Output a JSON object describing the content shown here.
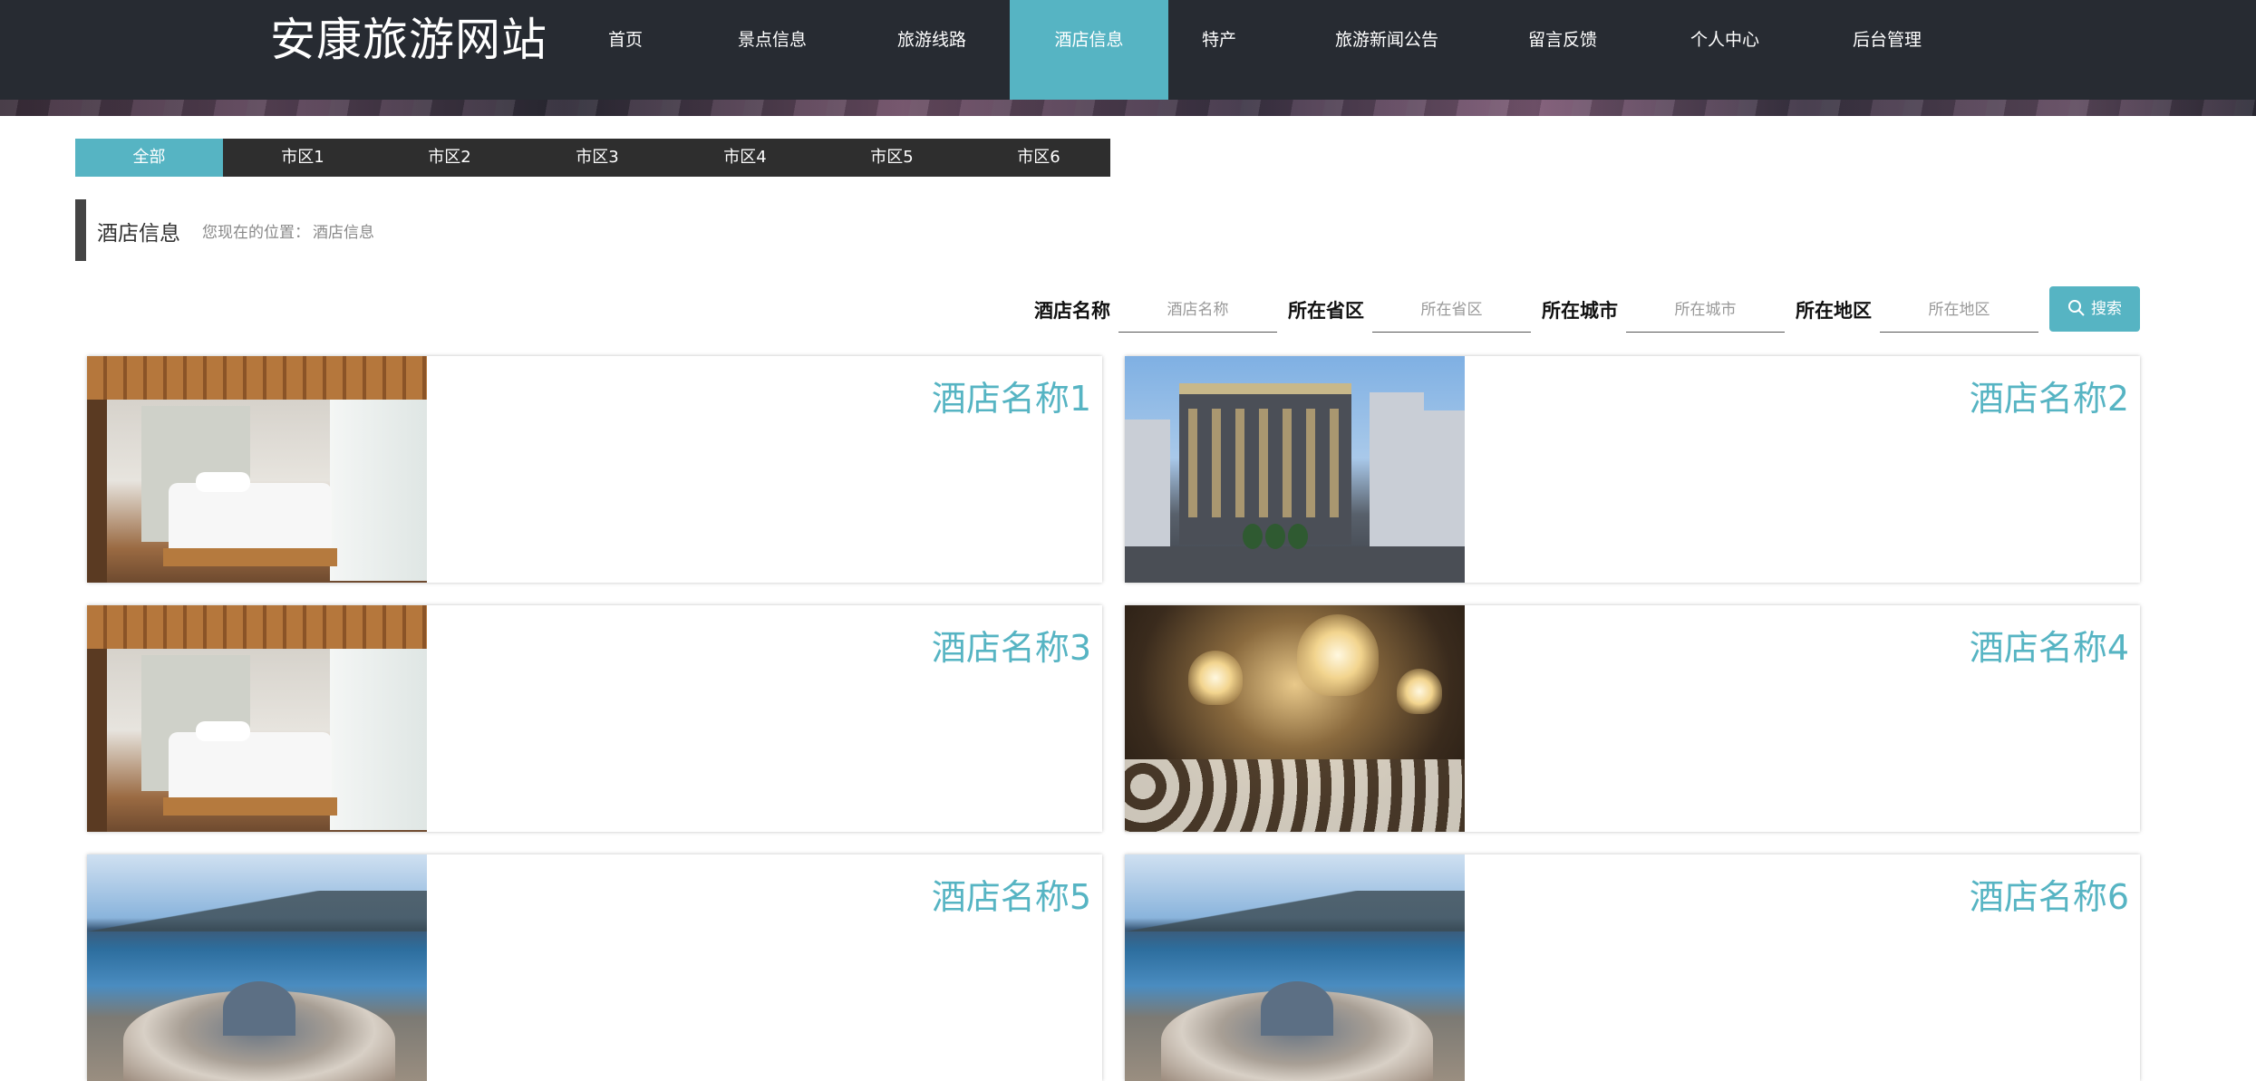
{
  "header": {
    "site_title": "安康旅游网站",
    "nav": [
      {
        "label": "首页",
        "active": false
      },
      {
        "label": "景点信息",
        "active": false
      },
      {
        "label": "旅游线路",
        "active": false
      },
      {
        "label": "酒店信息",
        "active": true
      },
      {
        "label": "特产",
        "active": false
      },
      {
        "label": "旅游新闻公告",
        "active": false
      },
      {
        "label": "留言反馈",
        "active": false
      },
      {
        "label": "个人中心",
        "active": false
      },
      {
        "label": "后台管理",
        "active": false
      }
    ]
  },
  "districts": {
    "tabs": [
      {
        "label": "全部",
        "active": true
      },
      {
        "label": "市区1",
        "active": false
      },
      {
        "label": "市区2",
        "active": false
      },
      {
        "label": "市区3",
        "active": false
      },
      {
        "label": "市区4",
        "active": false
      },
      {
        "label": "市区5",
        "active": false
      },
      {
        "label": "市区6",
        "active": false
      }
    ]
  },
  "page_heading": {
    "title": "酒店信息",
    "location_label": "您现在的位置：",
    "location_value": "酒店信息"
  },
  "search": {
    "fields": [
      {
        "label": "酒店名称",
        "placeholder": "酒店名称",
        "value": ""
      },
      {
        "label": "所在省区",
        "placeholder": "所在省区",
        "value": ""
      },
      {
        "label": "所在城市",
        "placeholder": "所在城市",
        "value": ""
      },
      {
        "label": "所在地区",
        "placeholder": "所在地区",
        "value": ""
      }
    ],
    "button_label": "搜索",
    "button_icon": "search-icon"
  },
  "hotels": [
    {
      "name": "酒店名称1",
      "photo": "hotel-room-photo"
    },
    {
      "name": "酒店名称2",
      "photo": "hotel-building-photo"
    },
    {
      "name": "酒店名称3",
      "photo": "hotel-room-photo"
    },
    {
      "name": "酒店名称4",
      "photo": "banquet-hall-photo"
    },
    {
      "name": "酒店名称5",
      "photo": "lakeside-resort-photo"
    },
    {
      "name": "酒店名称6",
      "photo": "lakeside-resort-photo"
    }
  ],
  "colors": {
    "accent": "#56b4c3",
    "header_bg": "#272b32",
    "tabs_bg": "#2e2e2e"
  }
}
